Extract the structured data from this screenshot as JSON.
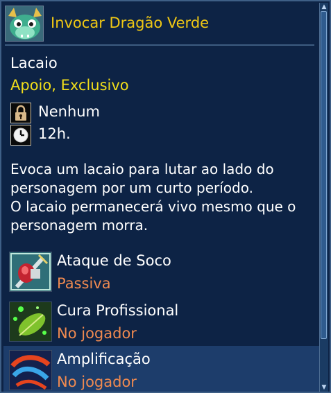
{
  "tooltip": {
    "title": "Invocar Dragão Verde",
    "category": "Lacaio",
    "tags": "Apoio, Exclusivo",
    "stats": [
      {
        "icon": "lock-icon",
        "value": "Nenhum"
      },
      {
        "icon": "clock-icon",
        "value": "12h."
      }
    ],
    "description": [
      "Evoca um lacaio para lutar ao lado do",
      "personagem por um curto período.",
      "O lacaio permanecerá vivo mesmo que o",
      "personagem morra."
    ],
    "skills": [
      {
        "name": "Ataque de Soco",
        "type": "Passiva",
        "icon": "punch-attack-icon"
      },
      {
        "name": "Cura Profissional",
        "type": "No jogador",
        "icon": "heal-leaf-icon"
      },
      {
        "name": "Amplificação",
        "type": "No jogador",
        "icon": "amplify-swirl-icon"
      }
    ]
  },
  "colors": {
    "background": "#0d2345",
    "title": "#f0c814",
    "tags": "#f2de1a",
    "skill_type": "#f08a50",
    "selected_row": "#1d3d6b"
  }
}
